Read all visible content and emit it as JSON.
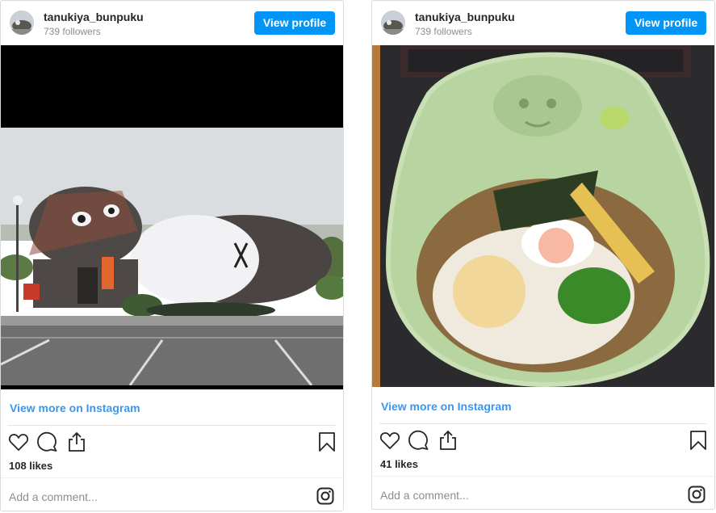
{
  "posts": [
    {
      "username": "tanukiya_bunpuku",
      "followers": "739 followers",
      "view_profile": "View profile",
      "view_more": "View more on Instagram",
      "likes": "108 likes",
      "comment_placeholder": "Add a comment...",
      "image": "photo of a giant tanuki-shaped building beside a parking lot"
    },
    {
      "username": "tanukiya_bunpuku",
      "followers": "739 followers",
      "view_profile": "View profile",
      "view_more": "View more on Instagram",
      "likes": "41 likes",
      "comment_placeholder": "Add a comment...",
      "image": "photo of a udon bowl topped with nori, egg, tempura bits and green onion in a tanuki-face ceramic bowl"
    }
  ],
  "icons": [
    "heart-icon",
    "comment-icon",
    "share-icon",
    "bookmark-icon",
    "instagram-icon"
  ],
  "colors": {
    "accent": "#0095f6",
    "link": "#3897f0",
    "text": "#262626",
    "muted": "#8e8e8e"
  }
}
